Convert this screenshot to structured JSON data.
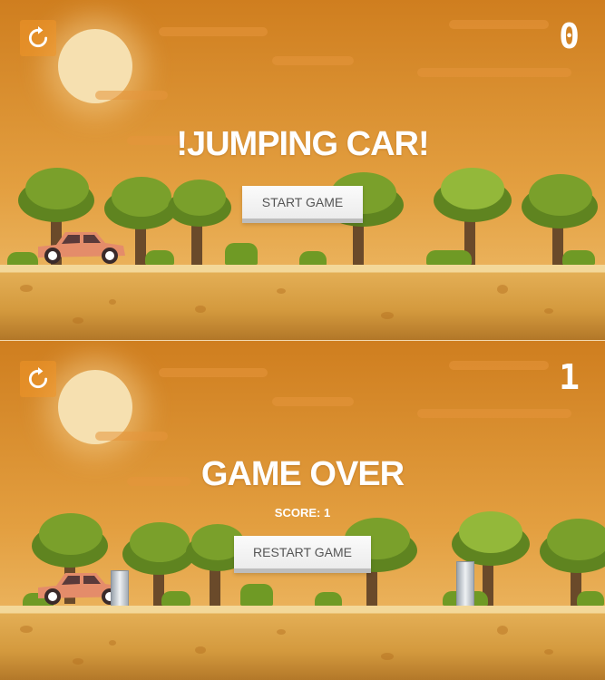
{
  "screen_start": {
    "title": "!JUMPING CAR!",
    "button": "START GAME",
    "score": "0"
  },
  "screen_over": {
    "title": "GAME OVER",
    "score_label": "SCORE: 1",
    "button": "RESTART GAME",
    "score": "1"
  },
  "icons": {
    "restart": "restart-icon"
  },
  "colors": {
    "sky_top": "#cf7e1f",
    "ground": "#e3ae55",
    "tree": "#7aa02b",
    "car": "#e48c6a"
  }
}
